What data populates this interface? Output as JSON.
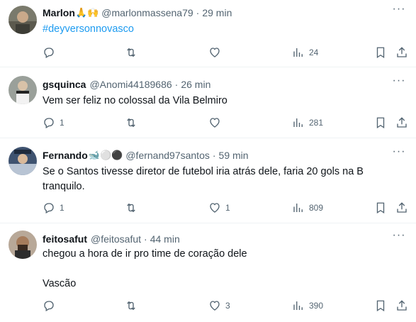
{
  "tweets": [
    {
      "name": "Marlon",
      "emoji": "🙏🙌",
      "handle": "@marlonmassena79",
      "time": "29 min",
      "text": "#deyversonnovasco",
      "replies": "",
      "likes": "",
      "views": "24",
      "avatar_color": "#6b6b5e"
    },
    {
      "name": "gsquinca",
      "emoji": "",
      "handle": "@Anomi44189686",
      "time": "26 min",
      "text": "Vem ser feliz no colossal da Vila Belmiro",
      "replies": "1",
      "likes": "",
      "views": "281",
      "avatar_color": "#8a8f8a"
    },
    {
      "name": "Fernando",
      "emoji": "🐋⚪⚫",
      "handle": "@fernand97santos",
      "time": "59 min",
      "text": "Se o Santos tivesse diretor de futebol iria atrás dele, faria 20 gols na B tranquilo.",
      "replies": "1",
      "likes": "1",
      "views": "809",
      "avatar_color": "#4a5e78"
    },
    {
      "name": "feitosafut",
      "emoji": "",
      "handle": "@feitosafut",
      "time": "44 min",
      "text": "chegou a hora de ir pro time de coração dele\n\nVascão",
      "replies": "",
      "likes": "3",
      "views": "390",
      "avatar_color": "#7d6a5c"
    }
  ],
  "icons": {
    "reply": "reply-icon",
    "retweet": "retweet-icon",
    "like": "heart-icon",
    "views": "views-icon",
    "bookmark": "bookmark-icon",
    "share": "share-icon",
    "more": "more-icon"
  },
  "colors": {
    "text": "#0f1419",
    "secondary": "#536471",
    "link": "#1d9bf0",
    "divider": "#eff3f4"
  }
}
